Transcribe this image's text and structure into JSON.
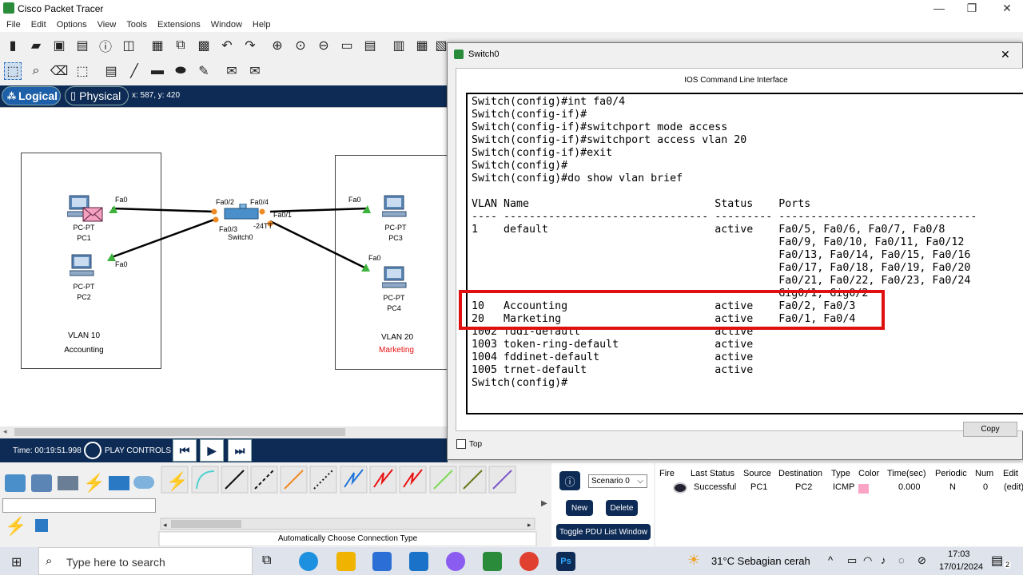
{
  "window": {
    "title": "Cisco Packet Tracer"
  },
  "menu": [
    "File",
    "Edit",
    "Options",
    "View",
    "Tools",
    "Extensions",
    "Window",
    "Help"
  ],
  "modes": {
    "logical": "Logical",
    "physical": "Physical",
    "coords": "x: 587, y: 420"
  },
  "topology": {
    "vlan10": {
      "name": "VLAN 10",
      "label": "Accounting",
      "label_color": "#000000"
    },
    "vlan20": {
      "name": "VLAN 20",
      "label": "Marketing",
      "label_color": "#e81010"
    },
    "devices": [
      {
        "id": "pc1",
        "type": "PC-PT",
        "name": "PC1",
        "port": "Fa0"
      },
      {
        "id": "pc2",
        "type": "PC-PT",
        "name": "PC2",
        "port": "Fa0"
      },
      {
        "id": "pc3",
        "type": "PC-PT",
        "name": "PC3",
        "port": "Fa0"
      },
      {
        "id": "pc4",
        "type": "PC-PT",
        "name": "PC4",
        "port": "Fa0"
      }
    ],
    "switch": {
      "model": "-24TT",
      "name": "Switch0",
      "ports": [
        "Fa0/2",
        "Fa0/4",
        "Fa0/1",
        "Fa0/3"
      ]
    }
  },
  "timebar": {
    "time": "Time: 00:19:51.998",
    "play_controls": "PLAY CONTROLS"
  },
  "connection_caption": "Automatically Choose Connection Type",
  "pdu": {
    "scenario": "Scenario 0",
    "new": "New",
    "delete": "Delete",
    "toggle": "Toggle PDU List Window"
  },
  "sim_table": {
    "headers": [
      "Fire",
      "Last Status",
      "Source",
      "Destination",
      "Type",
      "Color",
      "Time(sec)",
      "Periodic",
      "Num",
      "Edit"
    ],
    "row": [
      "",
      "Successful",
      "PC1",
      "PC2",
      "ICMP",
      "",
      "0.000",
      "N",
      "0",
      "(edit)"
    ],
    "pdu_color": "#f9a3c5"
  },
  "switch_window": {
    "title": "Switch0",
    "caption": "IOS Command Line Interface",
    "copy": "Copy",
    "top": "Top",
    "cli": [
      "Switch(config)#int fa0/4",
      "Switch(config-if)#",
      "Switch(config-if)#switchport mode access",
      "Switch(config-if)#switchport access vlan 20",
      "Switch(config-if)#exit",
      "Switch(config)#",
      "Switch(config)#do show vlan brief",
      "",
      "VLAN Name                             Status    Ports",
      "---- -------------------------------- --------- -------------------------------",
      "1    default                          active    Fa0/5, Fa0/6, Fa0/7, Fa0/8",
      "                                                Fa0/9, Fa0/10, Fa0/11, Fa0/12",
      "                                                Fa0/13, Fa0/14, Fa0/15, Fa0/16",
      "                                                Fa0/17, Fa0/18, Fa0/19, Fa0/20",
      "                                                Fa0/21, Fa0/22, Fa0/23, Fa0/24",
      "                                                Gig0/1, Gig0/2",
      "10   Accounting                       active    Fa0/2, Fa0/3",
      "20   Marketing                        active    Fa0/1, Fa0/4",
      "1002 fddi-default                     active",
      "1003 token-ring-default               active",
      "1004 fddinet-default                  active",
      "1005 trnet-default                    active",
      "Switch(config)#"
    ]
  },
  "taskbar": {
    "search_placeholder": "Type here to search",
    "weather": "31°C  Sebagian cerah",
    "time": "17:03",
    "date": "17/01/2024",
    "notifications": "2"
  },
  "colors": {
    "navy": "#0d2b55",
    "highlight": "#e01010",
    "link_green": "#3db33d",
    "link_orange": "#f08a24"
  }
}
